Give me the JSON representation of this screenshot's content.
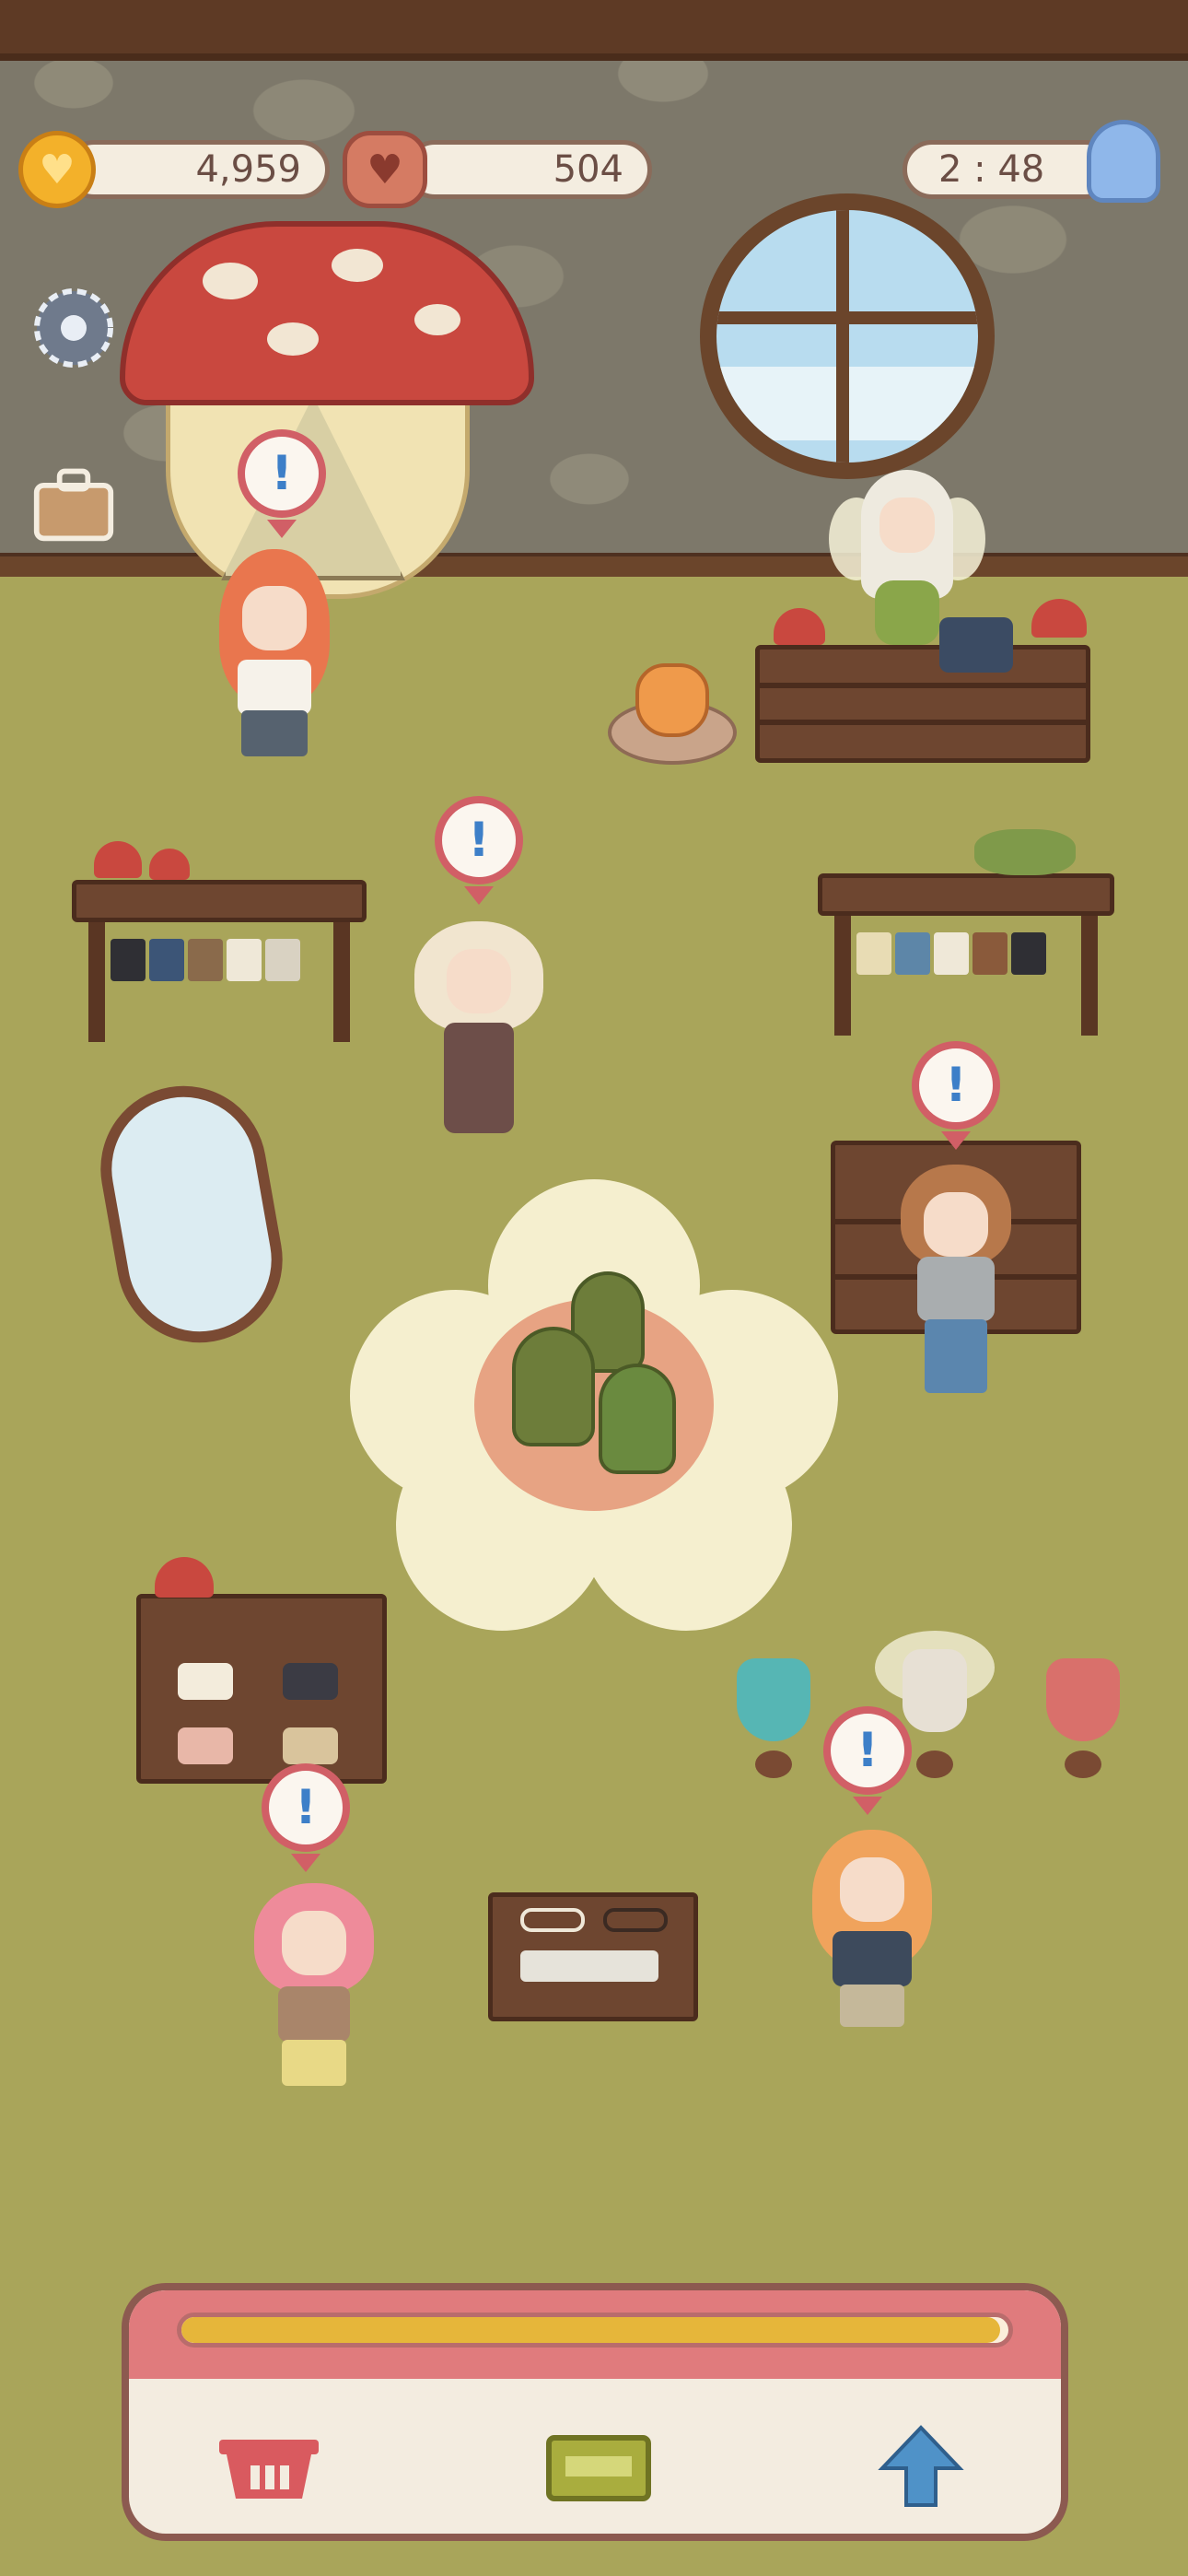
{
  "hud": {
    "coins": "4,959",
    "hearts": "504",
    "timer": "2 : 48",
    "coin_icon": "heart-coin-icon",
    "heart_icon": "heart-cookie-icon",
    "visitor_icon": "ghost-icon"
  },
  "side_buttons": [
    {
      "name": "settings-button",
      "icon": "gear-icon"
    },
    {
      "name": "bag-button",
      "icon": "briefcase-icon"
    }
  ],
  "customers": [
    {
      "name": "customer-red-hair",
      "alert": "!"
    },
    {
      "name": "customer-blonde-pigtails",
      "alert": "!"
    },
    {
      "name": "customer-brown-bob",
      "alert": "!"
    },
    {
      "name": "customer-pink-braid",
      "alert": "!"
    },
    {
      "name": "customer-orange-hair",
      "alert": "!"
    }
  ],
  "shopkeeper": {
    "name": "fairy-shopkeeper"
  },
  "bottom_panel": {
    "progress": 0.99,
    "buttons": [
      {
        "name": "basket-button",
        "icon": "basket-icon"
      },
      {
        "name": "display-button",
        "icon": "shelf-icon"
      },
      {
        "name": "upgrade-button",
        "icon": "arrow-up-icon"
      }
    ]
  },
  "colors": {
    "accent_red": "#d15f66",
    "floor": "#a9a55a",
    "alert_blue": "#3d7fc8",
    "progress": "#e6b63a"
  }
}
